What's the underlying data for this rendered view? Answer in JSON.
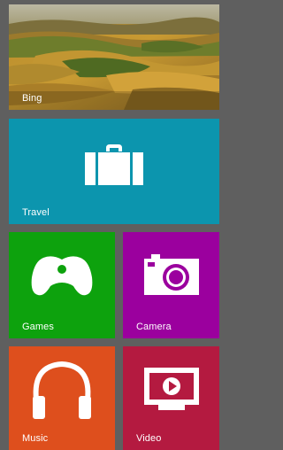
{
  "start_screen": {
    "tiles": [
      {
        "id": "bing",
        "label": "Bing",
        "icon": "landscape-photo",
        "color": "#7a6a2a"
      },
      {
        "id": "travel",
        "label": "Travel",
        "icon": "suitcase-icon",
        "color": "#0c95ae"
      },
      {
        "id": "games",
        "label": "Games",
        "icon": "game-controller-icon",
        "color": "#0da20d"
      },
      {
        "id": "camera",
        "label": "Camera",
        "icon": "camera-icon",
        "color": "#9b009e"
      },
      {
        "id": "music",
        "label": "Music",
        "icon": "headphones-icon",
        "color": "#de4f1d"
      },
      {
        "id": "video",
        "label": "Video",
        "icon": "video-play-icon",
        "color": "#b41a40"
      }
    ]
  }
}
